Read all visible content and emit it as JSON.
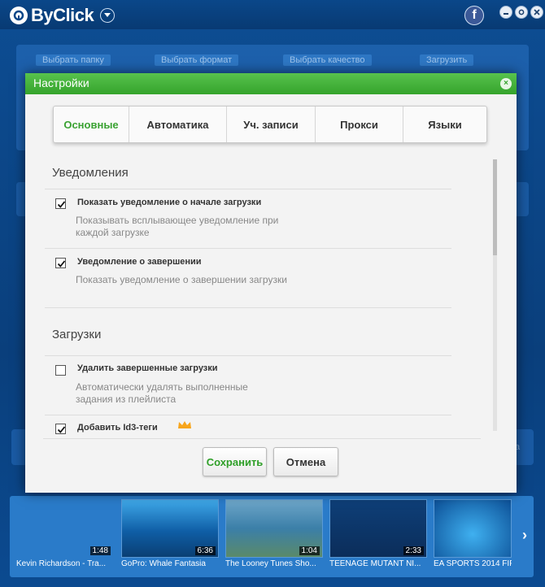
{
  "app": {
    "name": "ByClick",
    "facebook_glyph": "f",
    "bg_steps": [
      "Выбрать папку",
      "Выбрать формат",
      "Выбрать качество",
      "Загрузить"
    ],
    "bg_hint": "ка"
  },
  "dialog": {
    "title": "Настройки",
    "close_glyph": "×",
    "tabs": [
      "Основные",
      "Автоматика",
      "Уч. записи",
      "Прокси",
      "Языки"
    ],
    "active_tab": 0,
    "sections": {
      "notifications": {
        "title": "Уведомления",
        "options": [
          {
            "label": "Показать уведомление о начале загрузки",
            "desc": "Показывать всплывающее уведомление при каждой загрузке",
            "checked": true
          },
          {
            "label": "Уведомление о завершении",
            "desc": "Показать уведомление о завершении загрузки",
            "checked": true
          }
        ]
      },
      "downloads": {
        "title": "Загрузки",
        "options": [
          {
            "label": "Удалить завершенные загрузки",
            "desc": "Автоматически удалять выполненные задания из плейлиста",
            "checked": false
          },
          {
            "label": "Добавить Id3-теги",
            "desc": "",
            "checked": true,
            "premium_icon": "crown-icon"
          }
        ]
      }
    },
    "buttons": {
      "save": "Сохранить",
      "cancel": "Отмена"
    },
    "colors": {
      "header": "#3aa632",
      "active_tab": "#3aa232",
      "save_text": "#2f9f28"
    }
  },
  "thumbnails": [
    {
      "title": "Kevin Richardson - Tra...",
      "duration": "1:48"
    },
    {
      "title": "GoPro: Whale Fantasia",
      "duration": "6:36"
    },
    {
      "title": "The Looney Tunes Sho...",
      "duration": "1:04"
    },
    {
      "title": "TEENAGE MUTANT NI...",
      "duration": "2:33"
    },
    {
      "title": "EA SPORTS 2014 FIF",
      "duration": ""
    }
  ]
}
